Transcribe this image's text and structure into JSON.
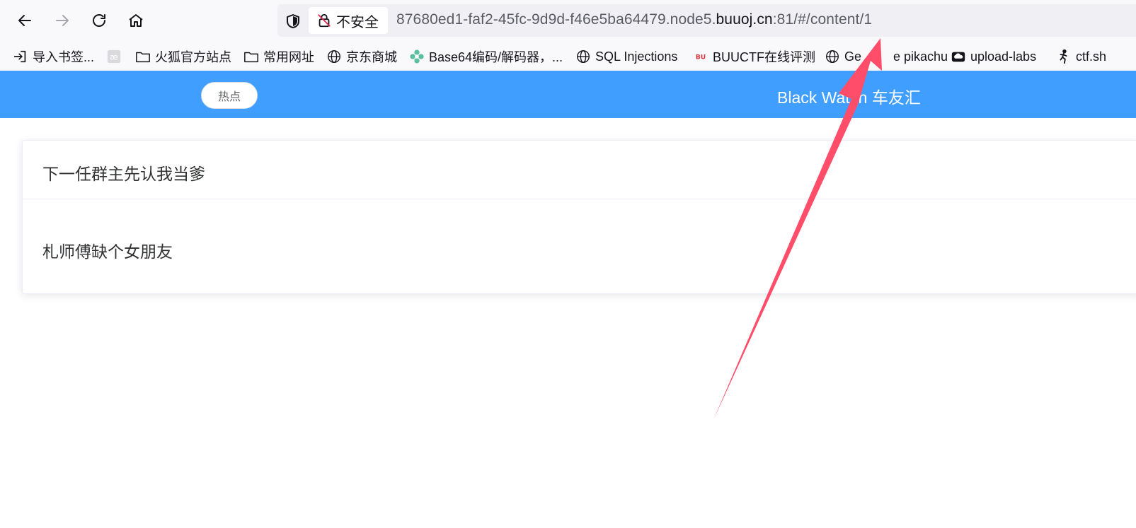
{
  "browser": {
    "nav": {
      "back_icon": "arrow-left-icon",
      "forward_icon": "arrow-right-icon",
      "reload_icon": "reload-icon",
      "home_icon": "home-icon"
    },
    "urlbar": {
      "security_label": "不安全",
      "url_prefix": "87680ed1-faf2-45fc-9d9d-f46e5ba64479.node5.",
      "url_host": "buuoj.cn",
      "url_suffix": ":81/#/content/1"
    },
    "bookmarks": [
      {
        "label": "导入书签...",
        "icon": "import-icon"
      },
      {
        "label": "",
        "icon": "ae-icon"
      },
      {
        "label": "火狐官方站点",
        "icon": "folder-icon"
      },
      {
        "label": "常用网址",
        "icon": "folder-icon"
      },
      {
        "label": "京东商城",
        "icon": "globe-icon"
      },
      {
        "label": "Base64编码/解码器，...",
        "icon": "flower-icon"
      },
      {
        "label": "SQL Injections",
        "icon": "globe-icon"
      },
      {
        "label": "BUUCTF在线评测",
        "icon": "buuctf-icon"
      },
      {
        "label": "Ge",
        "icon": "globe-icon"
      },
      {
        "label": "e pikachu",
        "icon": ""
      },
      {
        "label": "upload-labs",
        "icon": "cloud-icon"
      },
      {
        "label": "ctf.sh",
        "icon": "runner-icon"
      }
    ]
  },
  "app": {
    "hot_button": "热点",
    "brand_left": "Black Wat",
    "brand_right": "h 车友汇"
  },
  "card": {
    "title": "下一任群主先认我当爹",
    "body": "札师傅缺个女朋友"
  },
  "colors": {
    "header_bg": "#409eff",
    "arrow": "#ff4d6a"
  }
}
